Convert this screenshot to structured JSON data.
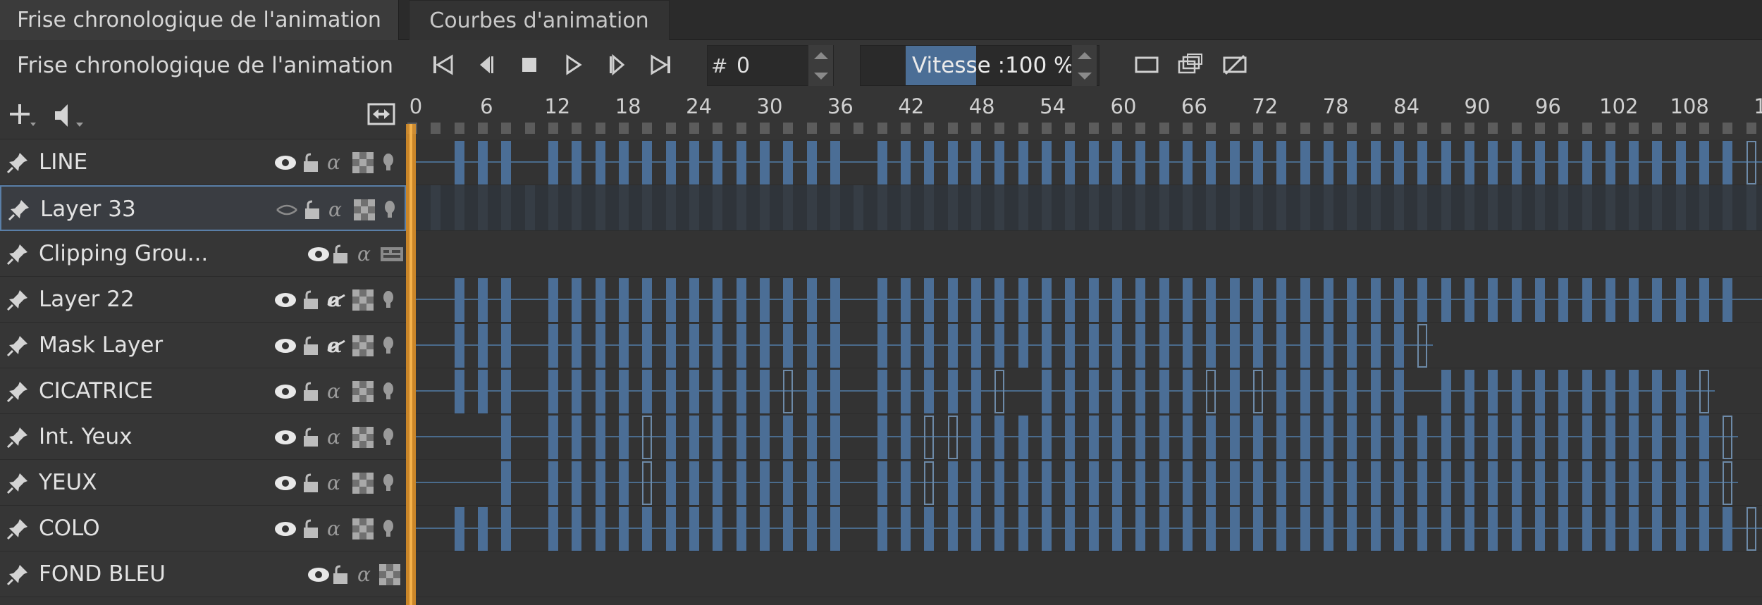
{
  "tabs": [
    {
      "label": "Frise chronologique de l'animation",
      "active": true
    },
    {
      "label": "Courbes d'animation",
      "active": false
    }
  ],
  "toolbar": {
    "dock_title": "Frise chronologique de l'animation",
    "transport_icons": [
      "skip-start-icon",
      "previous-keyframe-icon",
      "stop-icon",
      "play-icon",
      "next-keyframe-icon",
      "skip-end-icon"
    ],
    "frame_prefix": "#",
    "frame_value": "0",
    "speed_text": "Vitesse :100 %",
    "speed_fill_percent": 100,
    "view_icons": [
      "onion-skin-icon",
      "drop-frames-icon",
      "no-audio-icon"
    ]
  },
  "layer_header": {
    "icons": [
      "add-layer-icon",
      "audio-icon",
      "fit-width-icon"
    ]
  },
  "ruler": {
    "labels": [
      "0",
      "6",
      "12",
      "18",
      "24",
      "30",
      "36",
      "42",
      "48",
      "54",
      "60",
      "66",
      "72",
      "78",
      "84",
      "90",
      "96",
      "102",
      "108",
      "1"
    ],
    "frame_step": 6
  },
  "layers": [
    {
      "name": "LINE",
      "selected": false
    },
    {
      "name": "Layer 33",
      "selected": true
    },
    {
      "name": "Clipping Grou...",
      "selected": false
    },
    {
      "name": "Layer 22",
      "selected": false
    },
    {
      "name": "Mask Layer",
      "selected": false
    },
    {
      "name": "CICATRICE",
      "selected": false
    },
    {
      "name": "Int. Yeux",
      "selected": false
    },
    {
      "name": "YEUX",
      "selected": false
    },
    {
      "name": "COLO",
      "selected": false
    },
    {
      "name": "FOND BLEU",
      "selected": false
    }
  ],
  "colors": {
    "accent": "#4b6e96",
    "playhead": "#e0942a",
    "selected_border": "#5a7fa8"
  },
  "keyframes": {
    "LINE": {
      "filled": [
        2,
        3,
        4,
        6,
        7,
        8,
        9,
        10,
        11,
        12,
        13,
        14,
        15,
        16,
        17,
        18,
        20,
        21,
        22,
        23,
        24,
        25,
        26,
        27,
        28,
        29,
        30,
        31,
        32,
        33,
        34,
        35,
        36,
        37,
        38,
        39,
        40,
        41,
        42,
        43,
        44,
        45,
        46,
        47,
        48,
        49,
        50,
        51,
        52,
        53,
        54,
        55,
        56
      ],
      "empty": [
        57
      ],
      "extends_to_end": false
    },
    "Layer 33": {
      "filled": [],
      "empty": [],
      "extends_to_end": false
    },
    "Clipping Grou...": {
      "filled": [],
      "empty": [],
      "extends_to_end": false
    },
    "Layer 22": {
      "filled": [
        2,
        3,
        4,
        6,
        7,
        8,
        9,
        10,
        11,
        12,
        13,
        14,
        15,
        16,
        17,
        18,
        20,
        21,
        22,
        23,
        24,
        25,
        26,
        27,
        28,
        29,
        30,
        31,
        32,
        33,
        34,
        35,
        36,
        37,
        38,
        39,
        40,
        41,
        42,
        43,
        44,
        45,
        46,
        47,
        48,
        49,
        50,
        51,
        52,
        53,
        54,
        55,
        56
      ],
      "empty": [],
      "extends_to_end": true
    },
    "Mask Layer": {
      "filled": [
        2,
        3,
        4,
        6,
        7,
        8,
        9,
        10,
        11,
        12,
        13,
        14,
        15,
        16,
        17,
        18,
        20,
        21,
        22,
        23,
        24,
        25,
        26,
        27,
        28,
        29,
        30,
        31,
        32,
        33,
        34,
        35,
        36,
        37,
        38,
        39,
        40,
        41,
        42
      ],
      "empty": [
        43
      ],
      "extends_to_end": false
    },
    "CICATRICE": {
      "filled": [
        2,
        3,
        4,
        6,
        7,
        8,
        9,
        10,
        11,
        12,
        13,
        14,
        15,
        17,
        18,
        20,
        21,
        22,
        23,
        24,
        25,
        27,
        28,
        29,
        30,
        31,
        32,
        33,
        34,
        35,
        36,
        37,
        38,
        39,
        40,
        41,
        42,
        44,
        45,
        46,
        47,
        48,
        49,
        50,
        51,
        52,
        53,
        54
      ],
      "empty": [
        16,
        25,
        34,
        36,
        55
      ],
      "extends_to_end": false
    },
    "Int. Yeux": {
      "filled": [
        4,
        6,
        7,
        8,
        9,
        10,
        11,
        12,
        13,
        14,
        15,
        16,
        17,
        18,
        20,
        21,
        22,
        23,
        24,
        25,
        26,
        27,
        28,
        29,
        30,
        31,
        32,
        33,
        34,
        35,
        36,
        37,
        38,
        39,
        40,
        41,
        42,
        43,
        44,
        45,
        46,
        47,
        48,
        49,
        50,
        51,
        52,
        53,
        54,
        55
      ],
      "empty": [
        10,
        22,
        23,
        56
      ],
      "extends_to_end": false
    },
    "YEUX": {
      "filled": [
        4,
        6,
        7,
        8,
        9,
        10,
        11,
        12,
        13,
        14,
        15,
        16,
        17,
        18,
        20,
        21,
        22,
        23,
        24,
        25,
        26,
        27,
        28,
        29,
        30,
        31,
        32,
        33,
        34,
        35,
        36,
        37,
        38,
        39,
        40,
        41,
        42,
        43,
        44,
        45,
        46,
        47,
        48,
        49,
        50,
        51,
        52,
        53,
        54,
        55
      ],
      "empty": [
        10,
        22,
        56
      ],
      "extends_to_end": false
    },
    "COLO": {
      "filled": [
        2,
        3,
        4,
        6,
        7,
        8,
        9,
        10,
        11,
        12,
        13,
        14,
        15,
        16,
        17,
        18,
        20,
        21,
        22,
        23,
        24,
        25,
        26,
        27,
        28,
        29,
        30,
        31,
        32,
        33,
        34,
        35,
        36,
        37,
        38,
        39,
        40,
        41,
        42,
        43,
        44,
        45,
        46,
        47,
        48,
        49,
        50,
        51,
        52,
        53,
        54,
        55,
        56
      ],
      "empty": [
        57
      ],
      "extends_to_end": false
    },
    "FOND BLEU": {
      "filled": [],
      "empty": [],
      "extends_to_end": false
    }
  }
}
